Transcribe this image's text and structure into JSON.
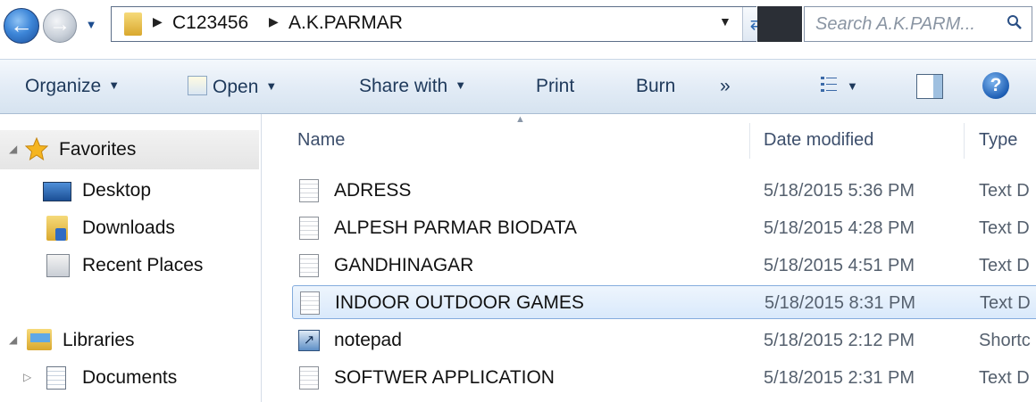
{
  "address_bar": {
    "breadcrumbs": [
      "C123456",
      "A.K.PARMAR"
    ],
    "search_placeholder": "Search A.K.PARM..."
  },
  "toolbar": {
    "organize": "Organize",
    "open": "Open",
    "share_with": "Share with",
    "print": "Print",
    "burn": "Burn",
    "more": "»"
  },
  "nav_pane": {
    "favorites": "Favorites",
    "desktop": "Desktop",
    "downloads": "Downloads",
    "recent_places": "Recent Places",
    "libraries": "Libraries",
    "documents": "Documents"
  },
  "columns": {
    "name": "Name",
    "date_modified": "Date modified",
    "type": "Type"
  },
  "files": [
    {
      "name": "ADRESS",
      "date": "5/18/2015 5:36 PM",
      "type": "Text D",
      "icon": "text-file-icon"
    },
    {
      "name": "ALPESH PARMAR BIODATA",
      "date": "5/18/2015 4:28 PM",
      "type": "Text D",
      "icon": "text-file-icon"
    },
    {
      "name": "GANDHINAGAR",
      "date": "5/18/2015 4:51 PM",
      "type": "Text D",
      "icon": "text-file-icon"
    },
    {
      "name": "INDOOR OUTDOOR GAMES",
      "date": "5/18/2015 8:31 PM",
      "type": "Text D",
      "icon": "text-file-icon",
      "selected": true
    },
    {
      "name": "notepad",
      "date": "5/18/2015 2:12 PM",
      "type": "Shortc",
      "icon": "shortcut-icon"
    },
    {
      "name": "SOFTWER APPLICATION",
      "date": "5/18/2015 2:31 PM",
      "type": "Text D",
      "icon": "text-file-icon"
    }
  ]
}
